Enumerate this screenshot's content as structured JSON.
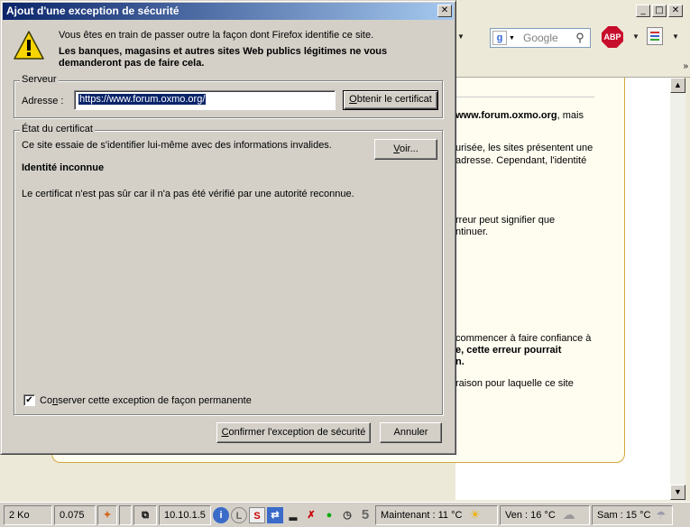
{
  "browser": {
    "search_placeholder": "Google",
    "abp_label": "ABP",
    "page_text": {
      "p1_url": "www.forum.oxmo.org",
      "p1_rest": ", mais",
      "p2_l1": "urisée, les sites présentent une",
      "p2_l2": "adresse. Cependant, l'identité",
      "p3_l1": "rreur peut signifier que",
      "p3_l2": "ntinuer.",
      "p4_l1": "commencer à faire confiance à",
      "p4_l2": "e, cette erreur pourrait",
      "p4_l3": "n.",
      "p5_l1": "raison pour laquelle ce site"
    },
    "statusbar": {
      "size": "2 Ko",
      "time": "0.075",
      "ip": "10.10.1.5",
      "digit": "5",
      "weather_now": "Maintenant : 11 °C",
      "weather_fri": "Ven : 16 °C",
      "weather_sat": "Sam : 15 °C"
    }
  },
  "dialog": {
    "title": "Ajout d'une exception de sécurité",
    "close_glyph": "✕",
    "intro_line1": "Vous êtes en train de passer outre la façon dont Firefox identifie ce site.",
    "intro_line2": "Les banques, magasins et autres sites Web publics légitimes ne vous demanderont pas de faire cela.",
    "server": {
      "legend": "Serveur",
      "address_label": "Adresse :",
      "address_value": "https://www.forum.oxmo.org/",
      "get_cert_pre": "O",
      "get_cert_rest": "btenir le certificat"
    },
    "cert_status": {
      "legend": "État du certificat",
      "message": "Ce site essaie de s'identifier lui-même avec des informations invalides.",
      "view_pre": "V",
      "view_rest": "oir...",
      "identity_title": "Identité inconnue",
      "identity_detail": "Le certificat n'est pas sûr car il n'a pas été vérifié par une autorité reconnue.",
      "permanent_pre": "Co",
      "permanent_u": "n",
      "permanent_rest": "server cette exception de façon permanente",
      "permanent_checked": true
    },
    "confirm_pre": "C",
    "confirm_rest": "onfirmer l'exception de sécurité",
    "cancel_label": "Annuler"
  }
}
